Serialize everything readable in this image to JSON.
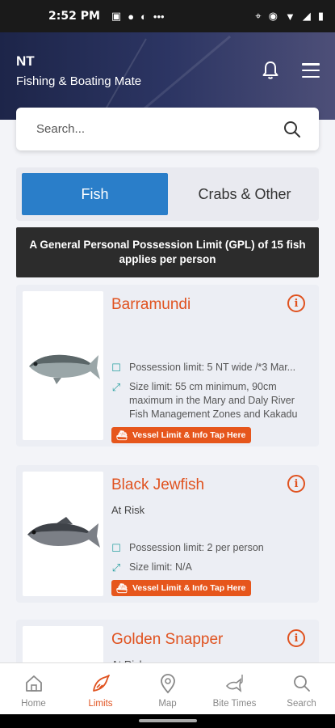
{
  "status_bar": {
    "time": "2:52 PM"
  },
  "header": {
    "region": "NT",
    "app_name": "Fishing & Boating Mate"
  },
  "search": {
    "placeholder": "Search..."
  },
  "tabs": [
    {
      "label": "Fish",
      "active": true
    },
    {
      "label": "Crabs & Other",
      "active": false
    }
  ],
  "banner": {
    "text": "A General Personal Possession Limit (GPL) of 15 fish applies per person"
  },
  "fish": [
    {
      "name": "Barramundi",
      "status": "",
      "possession": "Possession limit: 5 NT wide /*3 Mar...",
      "size": "Size limit: 55 cm minimum, 90cm maximum in the Mary and Daly River Fish Management Zones and Kakadu",
      "vessel_label": "Vessel Limit & Info Tap Here"
    },
    {
      "name": "Black Jewfish",
      "status": "At Risk",
      "possession": "Possession limit: 2 per person",
      "size": "Size limit: N/A",
      "vessel_label": "Vessel Limit & Info Tap Here"
    },
    {
      "name": "Golden Snapper",
      "status": "At Risk"
    }
  ],
  "nav": [
    {
      "label": "Home",
      "icon": "home-icon",
      "active": false
    },
    {
      "label": "Limits",
      "icon": "fish-icon",
      "active": true
    },
    {
      "label": "Map",
      "icon": "map-pin-icon",
      "active": false
    },
    {
      "label": "Bite Times",
      "icon": "bite-fish-icon",
      "active": false
    },
    {
      "label": "Search",
      "icon": "search-icon",
      "active": false
    }
  ],
  "colors": {
    "accent": "#e0521f",
    "primary_blue": "#2a7ec9",
    "header_navy": "#1d2549"
  }
}
